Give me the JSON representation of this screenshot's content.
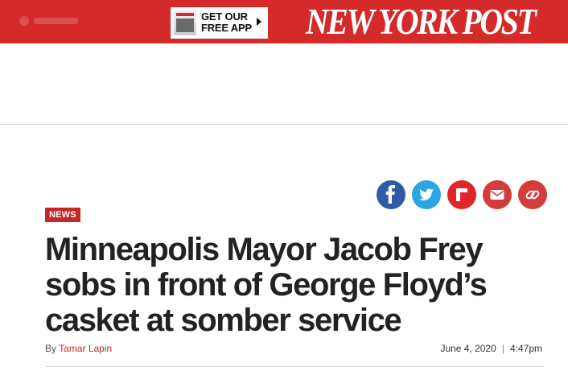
{
  "header": {
    "app_promo": {
      "line1": "GET OUR",
      "line2": "FREE APP"
    },
    "masthead": "NEW YORK POST",
    "colors": {
      "bar": "#d42a2a",
      "text": "#ffffff"
    }
  },
  "share": [
    {
      "name": "facebook",
      "icon": "facebook-icon",
      "color": "#2f5ba5"
    },
    {
      "name": "twitter",
      "icon": "twitter-icon",
      "color": "#2aa6e0"
    },
    {
      "name": "flipboard",
      "icon": "flipboard-icon",
      "color": "#e0252b"
    },
    {
      "name": "email",
      "icon": "email-icon",
      "color": "#d43b3b"
    },
    {
      "name": "copy-link",
      "icon": "link-icon",
      "color": "#d43b3b"
    }
  ],
  "article": {
    "section": "NEWS",
    "headline": "Minneapolis Mayor Jacob Frey sobs in front of George Floyd’s casket at somber service",
    "byline_prefix": "By",
    "author": "Tamar Lapin",
    "date": "June 4, 2020",
    "separator": "|",
    "time": "4:47pm",
    "accent_color": "#c62828"
  }
}
